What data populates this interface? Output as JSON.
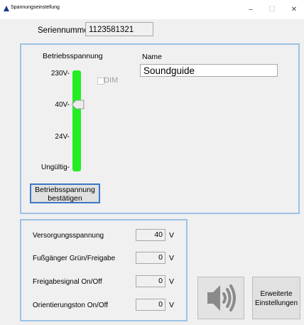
{
  "window": {
    "title": "Spannungseinstellung",
    "minimize_glyph": "–",
    "maximize_glyph": "☐",
    "close_glyph": "✕"
  },
  "serial": {
    "label": "Seriennummer",
    "value": "1123581321"
  },
  "operating_voltage": {
    "label": "Betriebsspannung",
    "ticks": [
      "230V-",
      "40V-",
      "24V-",
      "Ungültig-"
    ],
    "selected": "40V",
    "track_color": "#22ee22",
    "dim": {
      "label": "DIM",
      "checked": false,
      "enabled": false
    },
    "confirm_button_line1": "Betriebsspannung",
    "confirm_button_line2": "bestätigen"
  },
  "name": {
    "label": "Name",
    "value": "Soundguide"
  },
  "status": {
    "rows": [
      {
        "label": "Versorgungsspannung",
        "value": "40",
        "unit": "V"
      },
      {
        "label": "Fußgänger Grün/Freigabe",
        "value": "0",
        "unit": "V"
      },
      {
        "label": "Freigabesignal On/Off",
        "value": "0",
        "unit": "V"
      },
      {
        "label": "Orientierungston On/Off",
        "value": "0",
        "unit": "V"
      }
    ]
  },
  "buttons": {
    "speaker_icon": "speaker-volume-icon",
    "advanced_line1": "Erweiterte",
    "advanced_line2": "Einstellungen"
  },
  "colors": {
    "panel_border": "#9cc2e6",
    "focus_border": "#3a78c8",
    "speaker_icon": "#8a8a8a"
  }
}
